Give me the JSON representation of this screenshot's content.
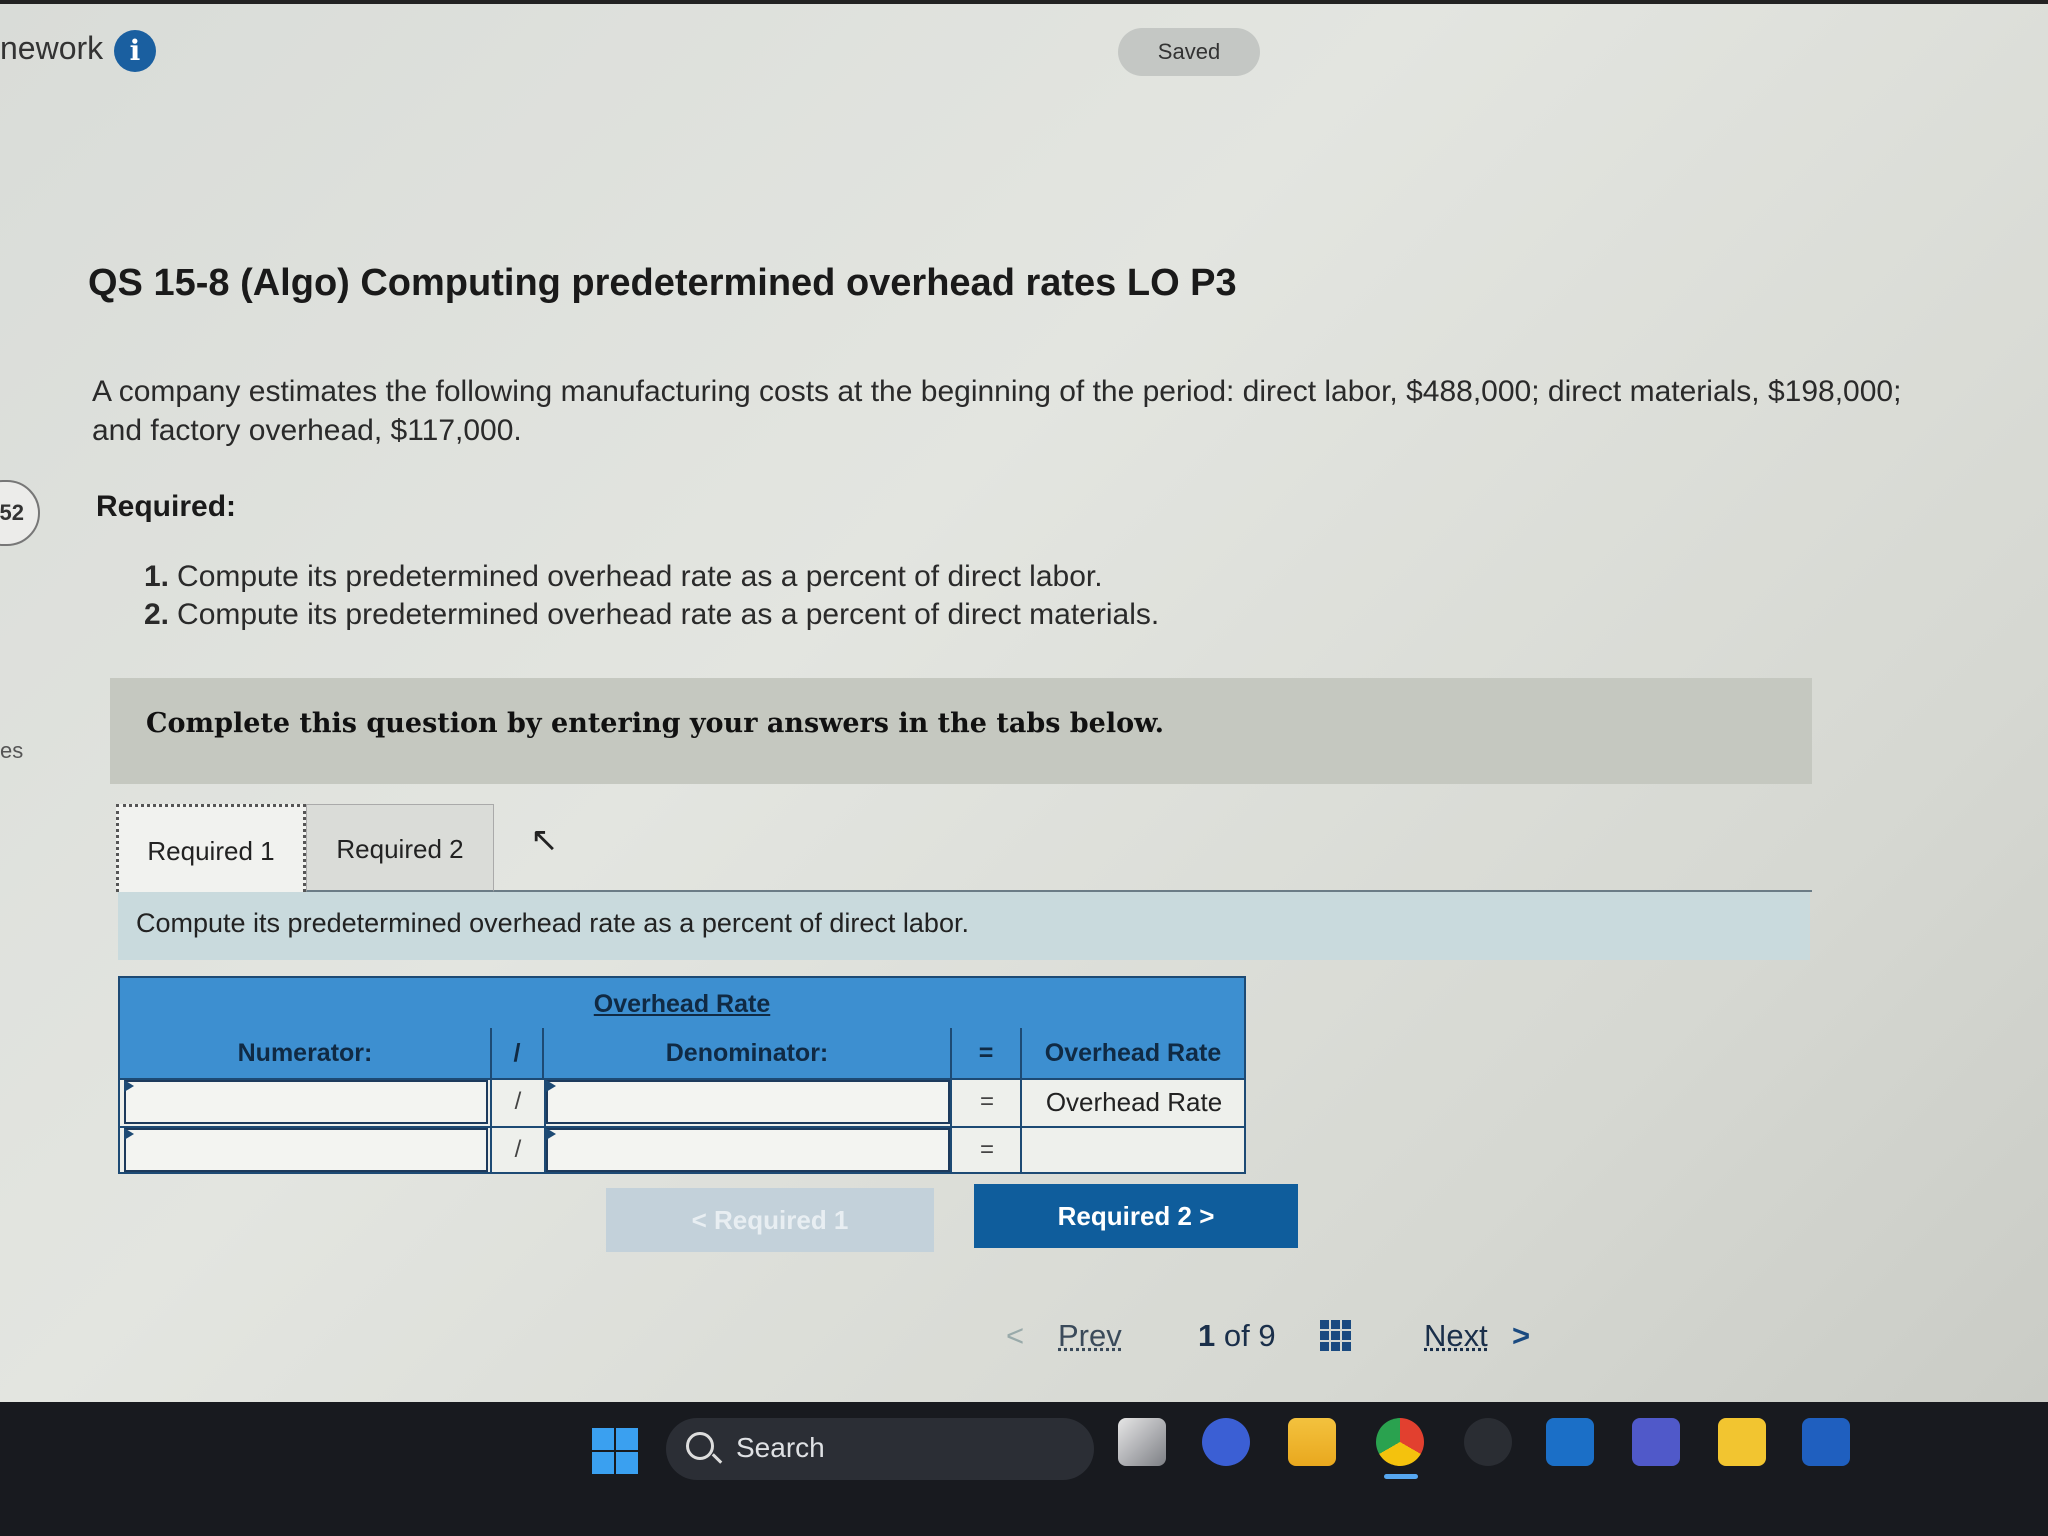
{
  "header": {
    "app_title": "nework",
    "saved_label": "Saved"
  },
  "sidebar": {
    "badge": "52",
    "label": "es"
  },
  "question": {
    "title": "QS 15-8 (Algo) Computing predetermined overhead rates LO P3",
    "text": "A company estimates the following manufacturing costs at the beginning of the period: direct labor, $488,000; direct materials, $198,000; and factory overhead, $117,000.",
    "required_heading": "Required:",
    "requirements": [
      {
        "num": "1.",
        "text": "Compute its predetermined overhead rate as a percent of direct labor."
      },
      {
        "num": "2.",
        "text": "Compute its predetermined overhead rate as a percent of direct materials."
      }
    ]
  },
  "instructions": "Complete this question by entering your answers in the tabs below.",
  "tabs": [
    {
      "label": "Required 1",
      "active": true
    },
    {
      "label": "Required 2",
      "active": false
    }
  ],
  "tab_prompt": "Compute its predetermined overhead rate as a percent of direct labor.",
  "grid": {
    "title": "Overhead Rate",
    "headers": {
      "numerator": "Numerator:",
      "divide": "/",
      "denominator": "Denominator:",
      "equals": "=",
      "result": "Overhead Rate"
    },
    "rows": [
      {
        "numerator": "",
        "divide": "/",
        "denominator": "",
        "equals": "=",
        "result": "Overhead Rate"
      },
      {
        "numerator": "",
        "divide": "/",
        "denominator": "",
        "equals": "=",
        "result": ""
      }
    ]
  },
  "nav_buttons": {
    "prev_label": "< Required 1",
    "next_label": "Required 2 >"
  },
  "pager": {
    "prev_chevron": "<",
    "prev": "Prev",
    "current": "1",
    "of": "of",
    "total": "9",
    "next": "Next",
    "next_chevron": ">"
  },
  "taskbar": {
    "search_label": "Search",
    "icons": [
      "windows-start-icon",
      "task-view-icon",
      "meet-icon",
      "file-explorer-icon",
      "chrome-icon",
      "cloud-icon",
      "outlook-icon",
      "teams-icon",
      "sticky-notes-icon",
      "word-icon"
    ]
  },
  "colors": {
    "grid_header": "#3d8fd0",
    "primary_button": "#0f5d9c",
    "disabled_button": "#c3d1da",
    "prompt_bar": "#c9dadd",
    "taskbar": "#181a1f"
  }
}
